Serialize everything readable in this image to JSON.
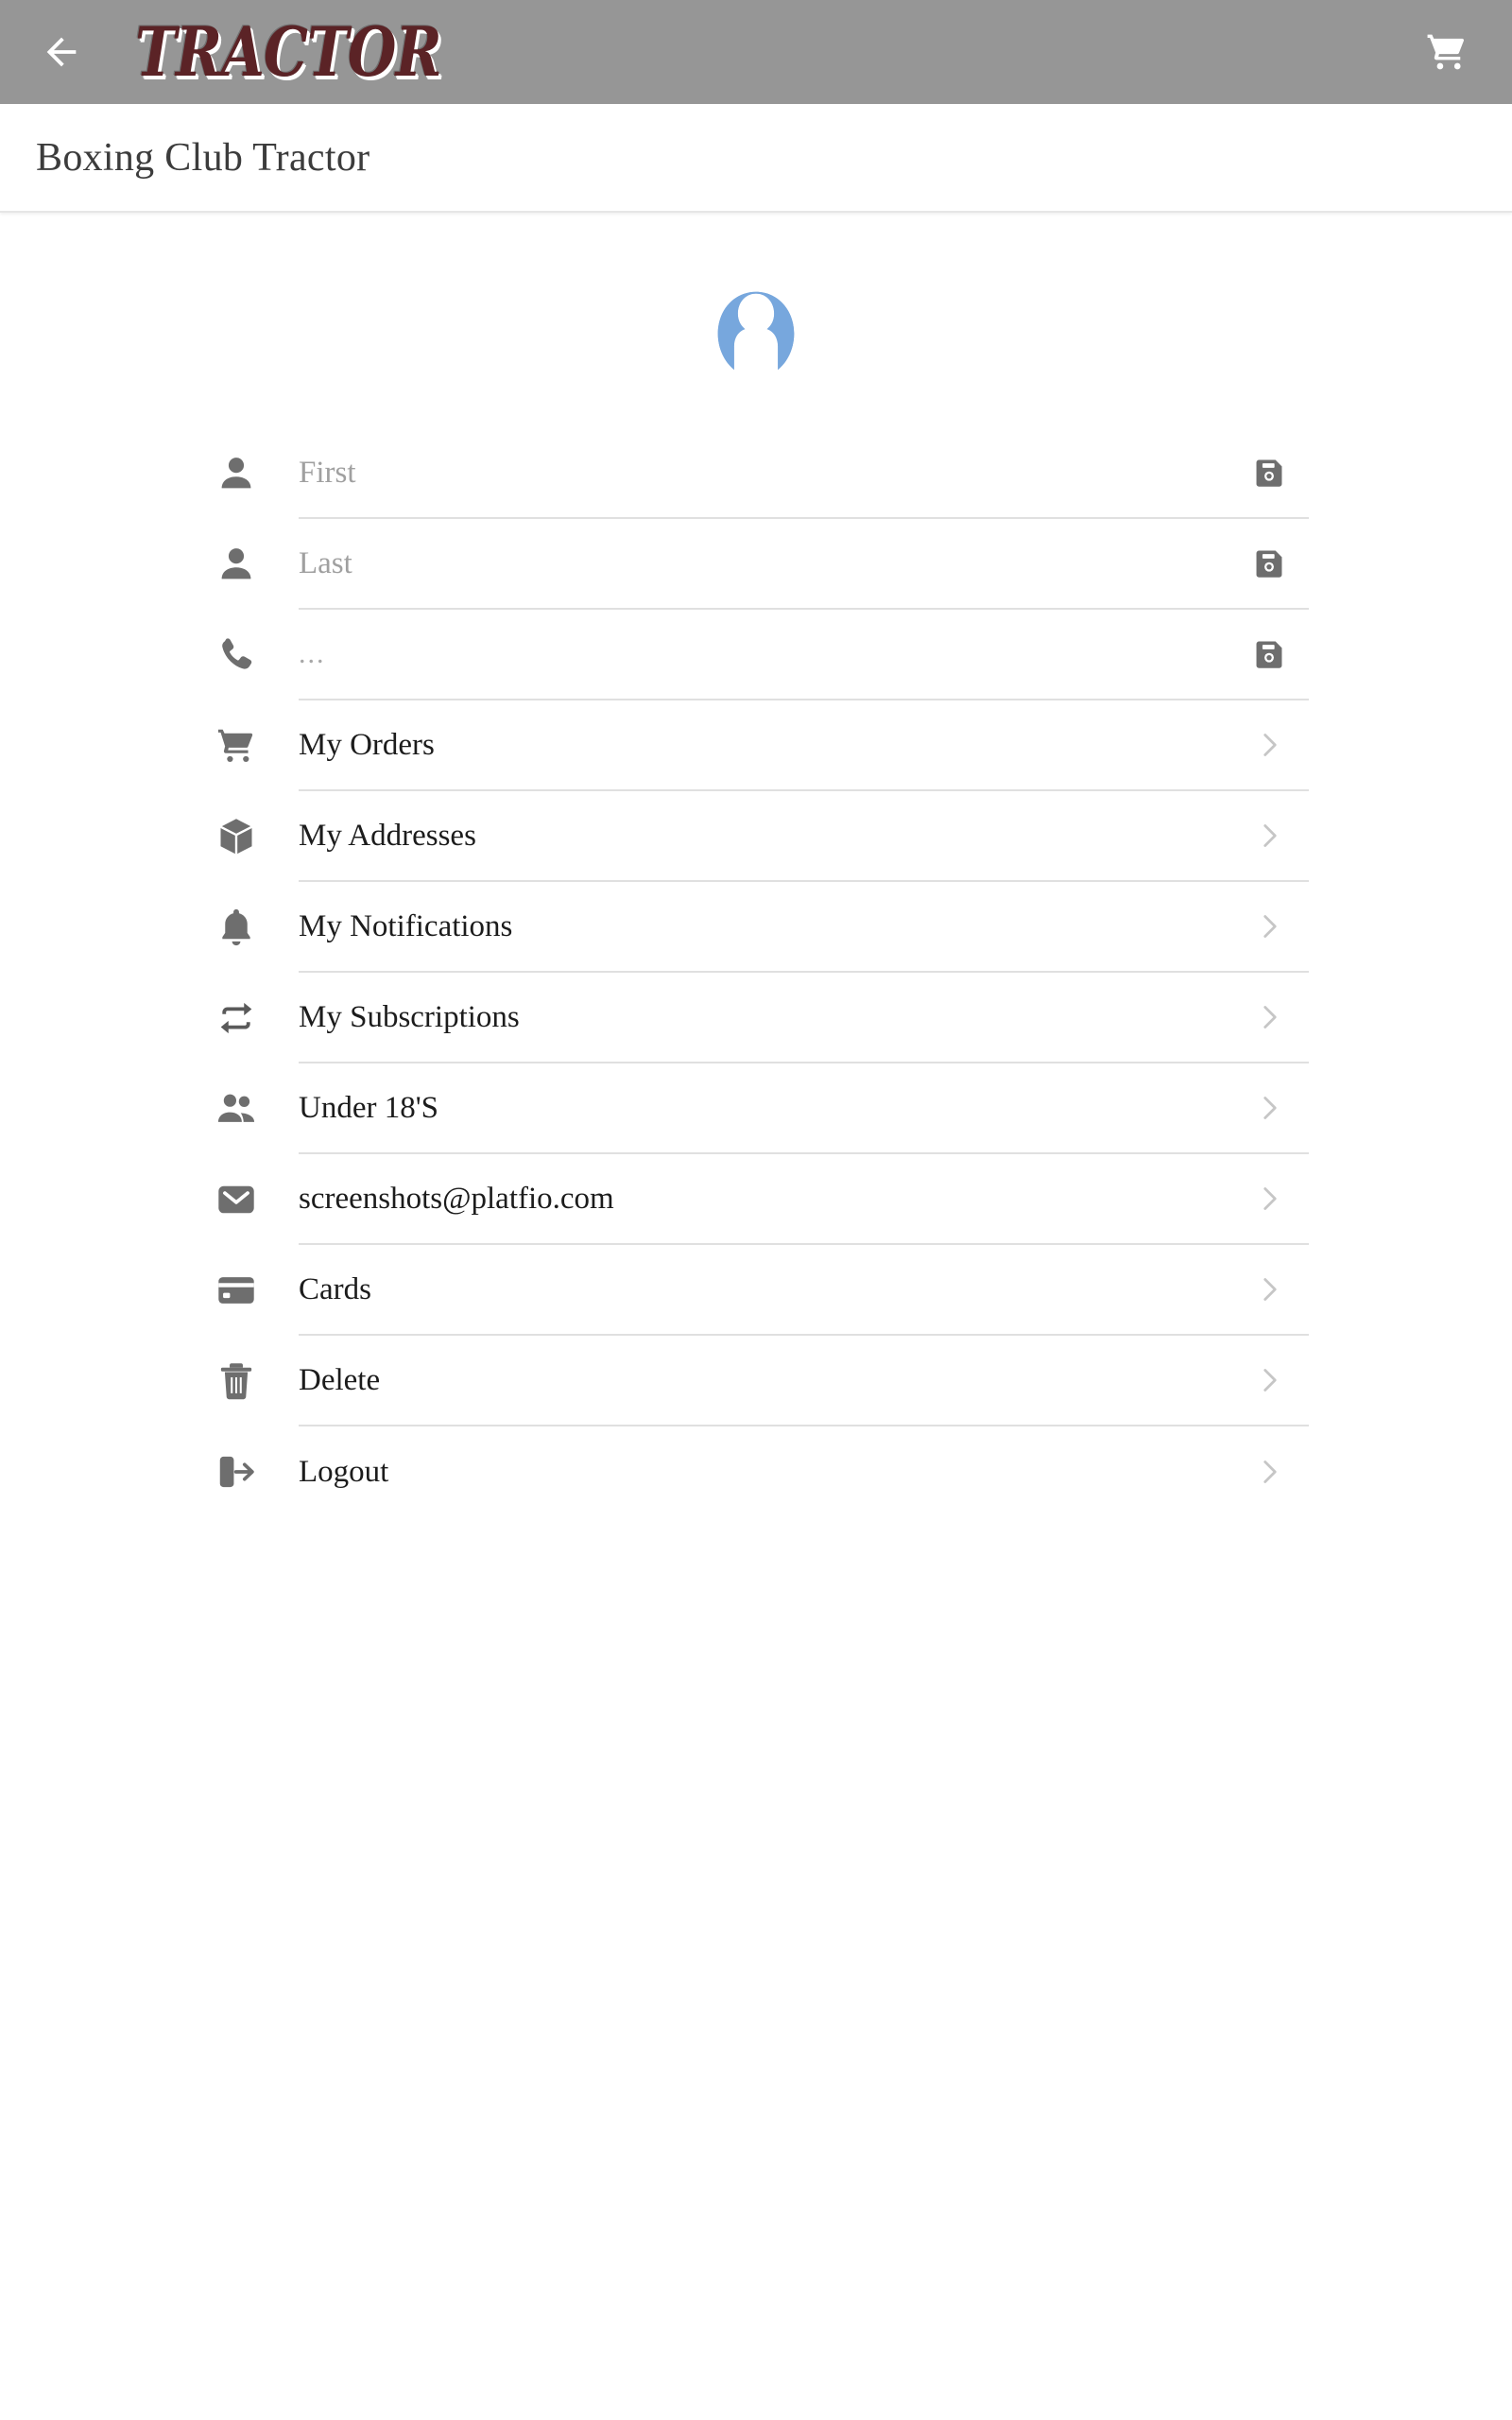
{
  "appbar": {
    "back_icon": "arrow-left-icon",
    "logo_text": "TRACTOR",
    "cart_icon": "shopping-cart-icon",
    "background_color": "#969696",
    "logo_color": "#5b2326"
  },
  "page": {
    "title": "Boxing Club Tractor"
  },
  "avatar": {
    "icon": "user-avatar-placeholder",
    "color": "#77a7dd"
  },
  "fields": [
    {
      "icon": "person-icon",
      "value": "",
      "placeholder": "First",
      "action_icon": "save-icon",
      "type": "text"
    },
    {
      "icon": "person-icon",
      "value": "",
      "placeholder": "Last",
      "action_icon": "save-icon",
      "type": "text"
    },
    {
      "icon": "phone-icon",
      "value": "...",
      "placeholder": "...",
      "action_icon": "save-icon",
      "type": "tel"
    }
  ],
  "menu": [
    {
      "icon": "shopping-cart-icon",
      "label": "My Orders",
      "action_icon": "chevron-right-icon"
    },
    {
      "icon": "box-icon",
      "label": "My Addresses",
      "action_icon": "chevron-right-icon"
    },
    {
      "icon": "bell-icon",
      "label": "My Notifications",
      "action_icon": "chevron-right-icon"
    },
    {
      "icon": "repeat-icon",
      "label": "My Subscriptions",
      "action_icon": "chevron-right-icon"
    },
    {
      "icon": "people-icon",
      "label": "Under 18'S",
      "action_icon": "chevron-right-icon"
    },
    {
      "icon": "envelope-icon",
      "label": "screenshots@platfio.com",
      "action_icon": "chevron-right-icon"
    },
    {
      "icon": "credit-card-icon",
      "label": "Cards",
      "action_icon": "chevron-right-icon"
    },
    {
      "icon": "trash-icon",
      "label": "Delete",
      "action_icon": "chevron-right-icon"
    },
    {
      "icon": "logout-icon",
      "label": "Logout",
      "action_icon": "chevron-right-icon"
    }
  ],
  "colors": {
    "icon_gray": "#6e6e6e",
    "divider": "#e0e0e0",
    "chevron": "#c6c6c6",
    "text": "#1c1c1c",
    "placeholder": "#a0a0a0"
  }
}
